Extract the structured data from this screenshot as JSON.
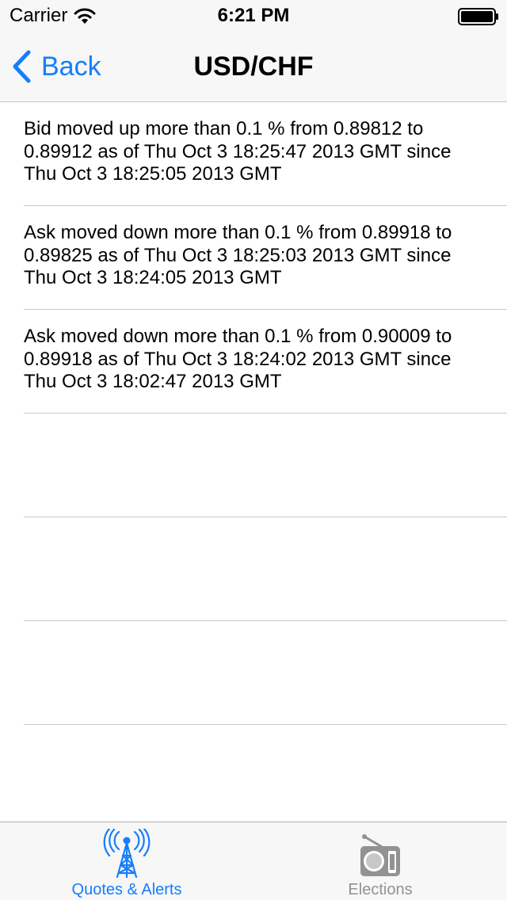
{
  "status_bar": {
    "carrier": "Carrier",
    "time": "6:21 PM",
    "wifi_icon": "wifi-icon",
    "battery_icon": "battery-full-icon"
  },
  "nav_bar": {
    "back_label": "Back",
    "title": "USD/CHF"
  },
  "alerts": [
    {
      "text": "Bid moved up more than 0.1 % from 0.89812 to\n0.89912 as of Thu Oct  3 18:25:47 2013 GMT since\nThu Oct  3 18:25:05 2013 GMT"
    },
    {
      "text": "Ask moved down more than 0.1 % from 0.89918 to\n0.89825 as of Thu Oct  3 18:25:03 2013 GMT since\nThu Oct  3 18:24:05 2013 GMT"
    },
    {
      "text": "Ask moved down more than 0.1 % from 0.90009 to\n0.89918 as of Thu Oct  3 18:24:02 2013 GMT since\nThu Oct  3 18:02:47 2013 GMT"
    },
    {
      "text": ""
    },
    {
      "text": ""
    },
    {
      "text": ""
    }
  ],
  "tab_bar": {
    "tabs": [
      {
        "label": "Quotes & Alerts",
        "icon": "radio-tower-icon",
        "active": true
      },
      {
        "label": "Elections",
        "icon": "radio-icon",
        "active": false
      }
    ]
  },
  "colors": {
    "accent": "#157efb",
    "inactive": "#929292",
    "separator": "#c8c7cc",
    "bar_background": "#f7f7f7"
  }
}
